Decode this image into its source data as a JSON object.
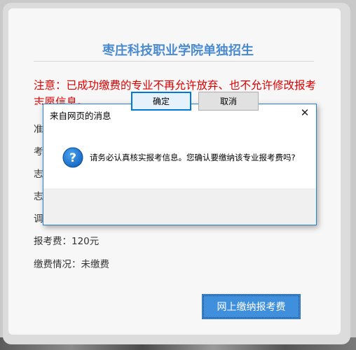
{
  "page": {
    "title": "枣庄科技职业学院单独招生",
    "notice": "注意：已成功缴费的专业不再允许放弃、也不允许修改报考志愿信息。",
    "fields_partial": [
      "准",
      "考",
      "志",
      "志",
      "调"
    ],
    "fee": "报考费：120元",
    "payment_status": "缴费情况：未缴费",
    "pay_button_label": "网上缴纳报考费"
  },
  "dialog": {
    "title": "来自网页的消息",
    "close_icon": "close-icon",
    "icon": "question-icon",
    "message": "请务必认真核实报考信息。您确认要缴纳该专业报考费吗?",
    "ok_label": "确定",
    "cancel_label": "取消"
  },
  "colors": {
    "title_blue": "#4a8bd0",
    "notice_red": "#e00000",
    "button_blue": "#3f8fdc",
    "dialog_border": "#2a80d8"
  }
}
